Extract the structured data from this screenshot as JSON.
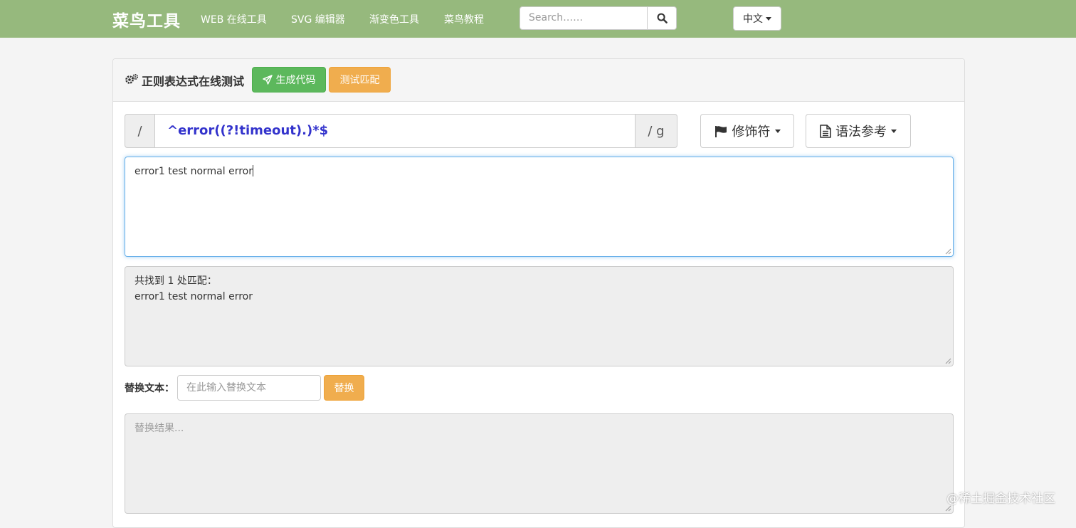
{
  "navbar": {
    "brand": "菜鸟工具",
    "links": [
      "WEB 在线工具",
      "SVG 编辑器",
      "渐变色工具",
      "菜鸟教程"
    ],
    "search_placeholder": "Search……",
    "language": "中文",
    "background_color": "#96b97d"
  },
  "panel": {
    "title": "正则表达式在线测试",
    "generate_button": "生成代码",
    "test_button": "测试匹配"
  },
  "regex": {
    "prefix": "/",
    "pattern": "^error((?!timeout).)*$",
    "suffix": "/ g",
    "modifiers_button": "修饰符",
    "syntax_button": "语法参考"
  },
  "test_text": "error1 test normal error",
  "result": {
    "summary": "共找到 1 处匹配：",
    "match": "error1 test normal error"
  },
  "replace": {
    "label": "替换文本：",
    "placeholder": "在此输入替换文本",
    "button": "替换",
    "result_placeholder": "替换结果..."
  },
  "watermark": "@稀土掘金技术社区",
  "icons": [
    "gears-icon",
    "send-icon",
    "flag-icon",
    "file-text-icon",
    "search-icon"
  ],
  "colors": {
    "success": "#5cb85c",
    "warning": "#f0ad4e",
    "regex_text": "#3333cc"
  }
}
